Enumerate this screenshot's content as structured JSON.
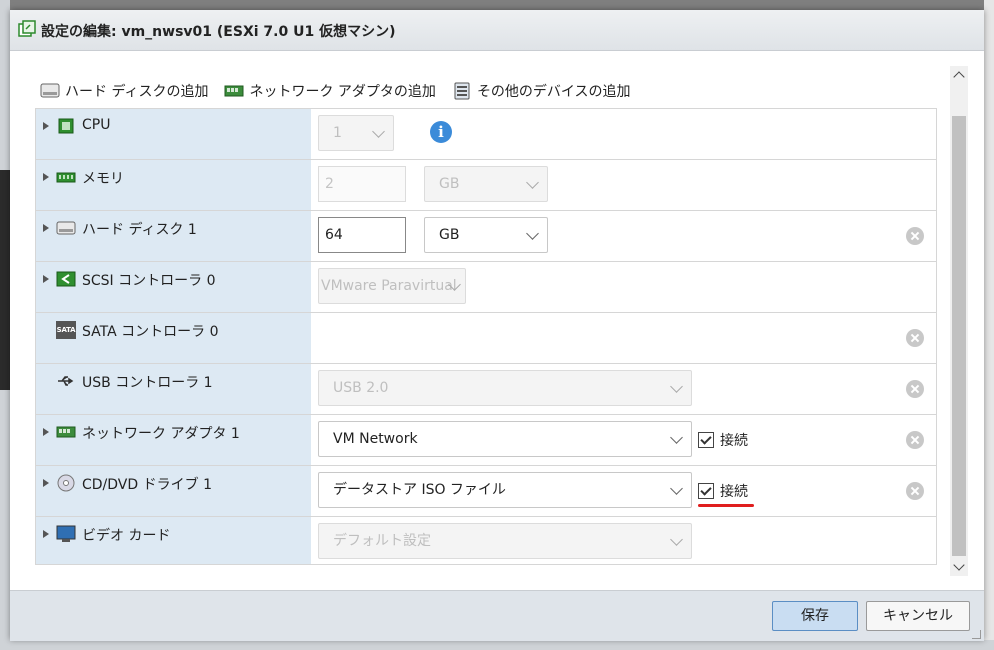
{
  "dialog": {
    "title": "設定の編集: vm_nwsv01 (ESXi 7.0 U1 仮想マシン)",
    "title_icon": "vm-edit-icon"
  },
  "toolbar": {
    "add_disk": "ハード ディスクの追加",
    "add_nic": "ネットワーク アダプタの追加",
    "add_other": "その他のデバイスの追加"
  },
  "devices": {
    "cpu": {
      "label": "CPU",
      "value": "1",
      "icon": "cpu-icon"
    },
    "memory": {
      "label": "メモリ",
      "value": "2",
      "unit": "GB",
      "icon": "memory-icon"
    },
    "disk": {
      "label": "ハード ディスク 1",
      "value": "64",
      "unit": "GB",
      "icon": "hard-disk-icon"
    },
    "scsi": {
      "label": "SCSI コントローラ 0",
      "value": "VMware Paravirtual",
      "icon": "scsi-controller-icon"
    },
    "sata": {
      "label": "SATA コントローラ 0",
      "icon": "sata-controller-icon",
      "icon_text": "SATA"
    },
    "usb": {
      "label": "USB コントローラ 1",
      "value": "USB 2.0",
      "icon": "usb-icon"
    },
    "nic": {
      "label": "ネットワーク アダプタ 1",
      "value": "VM Network",
      "connect_label": "接続",
      "connected": true,
      "icon": "network-adapter-icon"
    },
    "cdrom": {
      "label": "CD/DVD ドライブ 1",
      "value": "データストア ISO ファイル",
      "connect_label": "接続",
      "connected": true,
      "icon": "cd-dvd-icon"
    },
    "video": {
      "label": "ビデオ カード",
      "value": "デフォルト設定",
      "icon": "video-card-icon"
    }
  },
  "footer": {
    "save_label": "保存",
    "cancel_label": "キャンセル"
  },
  "colors": {
    "label_column": "#dde9f3",
    "save_button": "#c9ddf2",
    "annotation_underline": "#e01e1e"
  }
}
